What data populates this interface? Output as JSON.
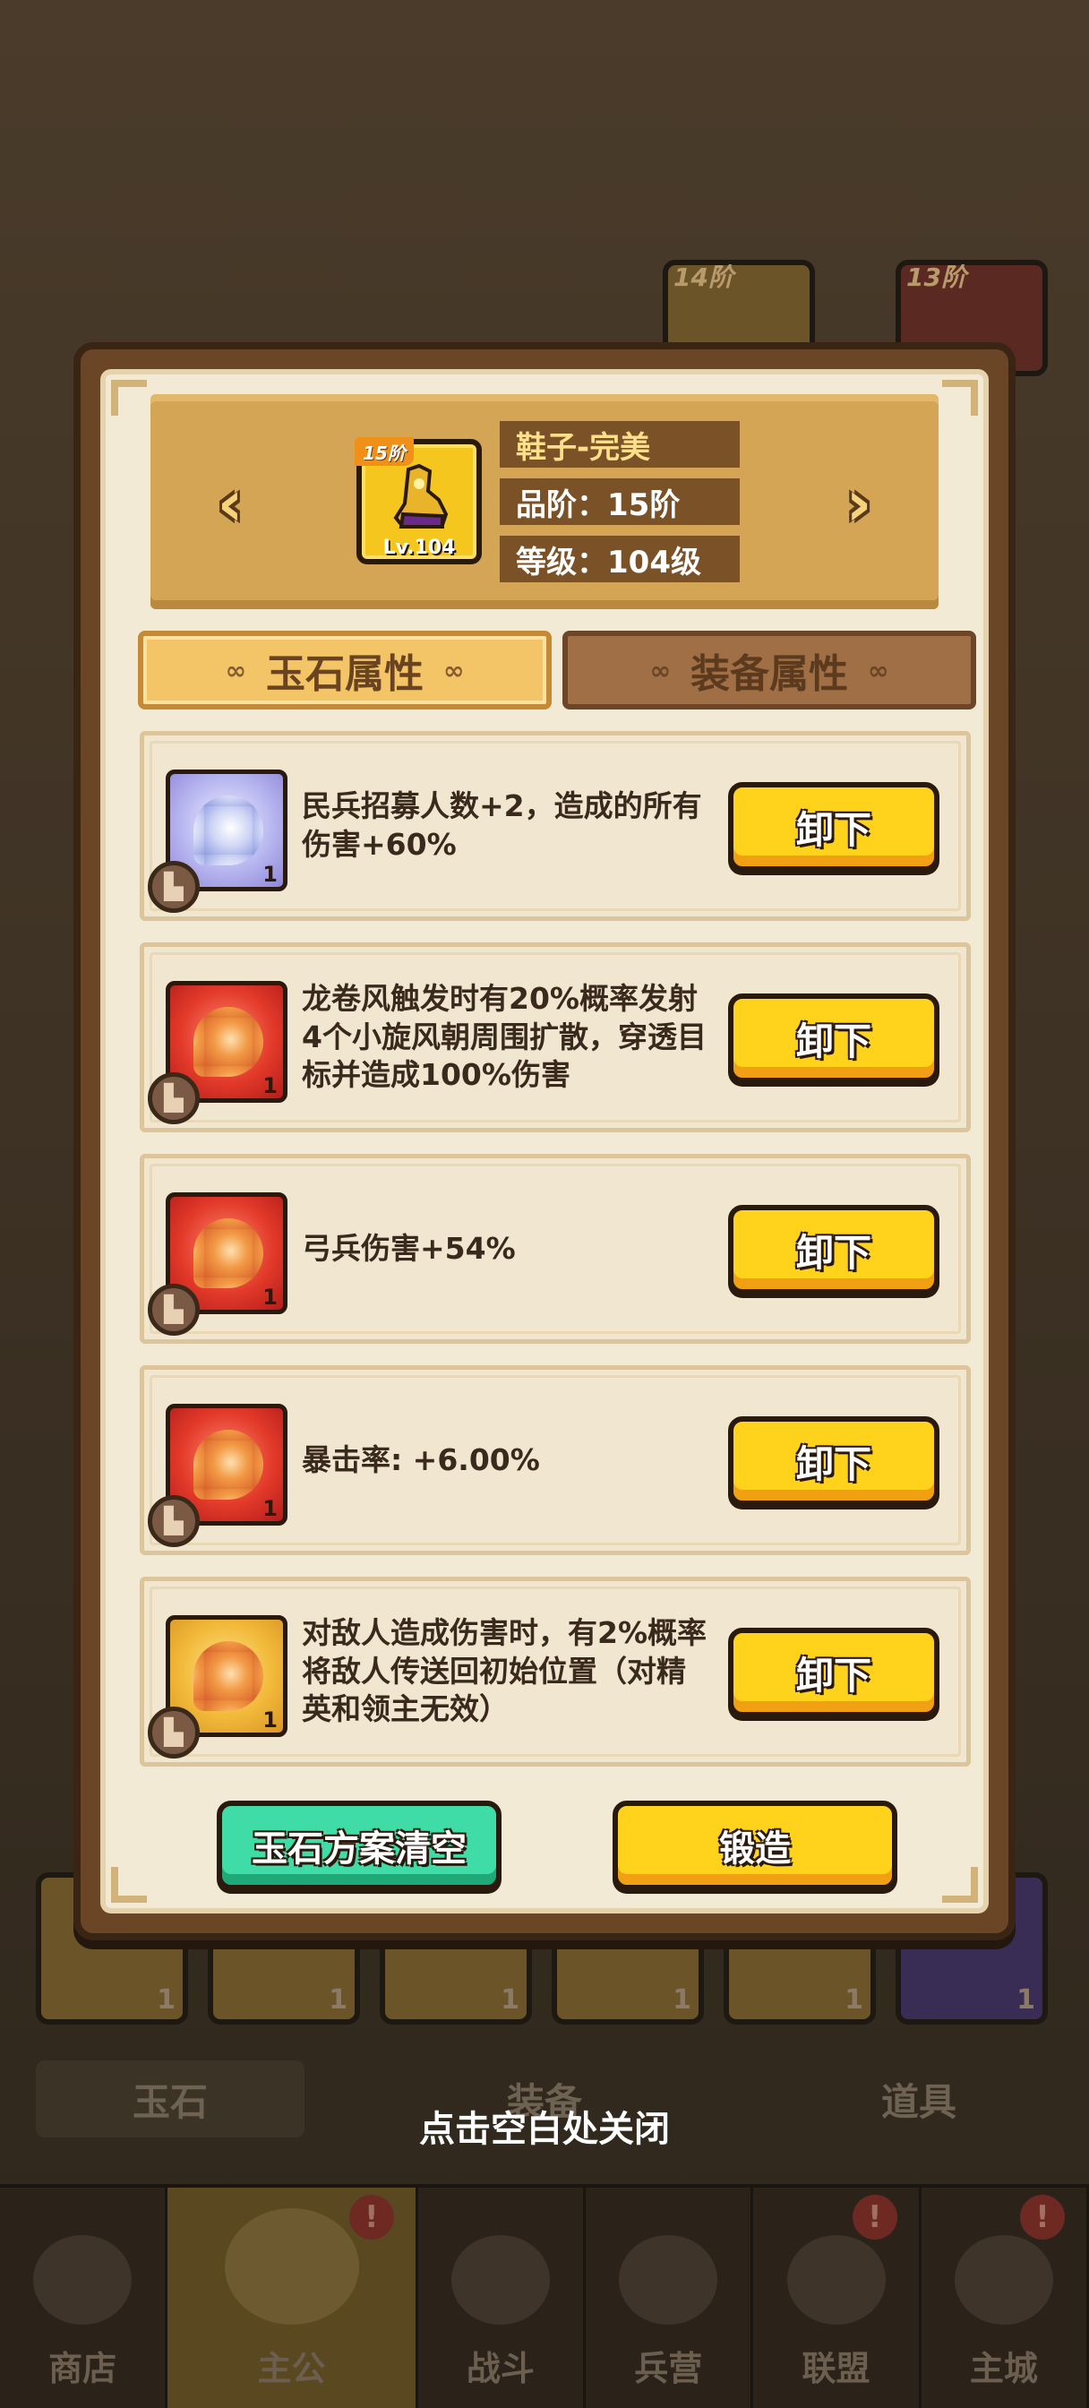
{
  "item": {
    "name": "鞋子-完美",
    "tier_badge": "15阶",
    "level_badge": "Lv.104",
    "quality_line": "品阶：15阶",
    "level_line": "等级：104级"
  },
  "tabs": [
    {
      "label": "玉石属性",
      "active": true
    },
    {
      "label": "装备属性",
      "active": false
    }
  ],
  "gems": [
    {
      "color": "blue",
      "swirl": "white",
      "count": "1",
      "desc": "民兵招募人数+2，造成的所有伤害+60%",
      "button": "卸下"
    },
    {
      "color": "red",
      "swirl": "orange",
      "count": "1",
      "desc": "龙卷风触发时有20%概率发射4个小旋风朝周围扩散，穿透目标并造成100%伤害",
      "button": "卸下"
    },
    {
      "color": "red",
      "swirl": "orange",
      "count": "1",
      "desc": "弓兵伤害+54%",
      "button": "卸下"
    },
    {
      "color": "red",
      "swirl": "orange",
      "count": "1",
      "desc": "暴击率: +6.00%",
      "button": "卸下"
    },
    {
      "color": "gold",
      "swirl": "orange",
      "count": "1",
      "desc": "对敌人造成伤害时，有2%概率将敌人传送回初始位置（对精英和领主无效）",
      "button": "卸下"
    }
  ],
  "actions": {
    "clear_label": "玉石方案清空",
    "forge_label": "锻造"
  },
  "close_hint": "点击空白处关闭",
  "background": {
    "tabs": [
      "玉石",
      "装备",
      "道具"
    ],
    "nav": [
      {
        "label": "商店",
        "active": false,
        "alert": false
      },
      {
        "label": "主公",
        "active": true,
        "alert": true
      },
      {
        "label": "战斗",
        "active": false,
        "alert": false
      },
      {
        "label": "兵营",
        "active": false,
        "alert": false
      },
      {
        "label": "联盟",
        "active": false,
        "alert": true
      },
      {
        "label": "主城",
        "active": false,
        "alert": true
      }
    ],
    "card_tiers": [
      "14阶",
      "13阶"
    ]
  },
  "colors": {
    "button_yellow": "#ffd21c",
    "button_green": "#3fdca8",
    "panel_bg": "#f3ead6",
    "frame_brown": "#6a4526"
  }
}
